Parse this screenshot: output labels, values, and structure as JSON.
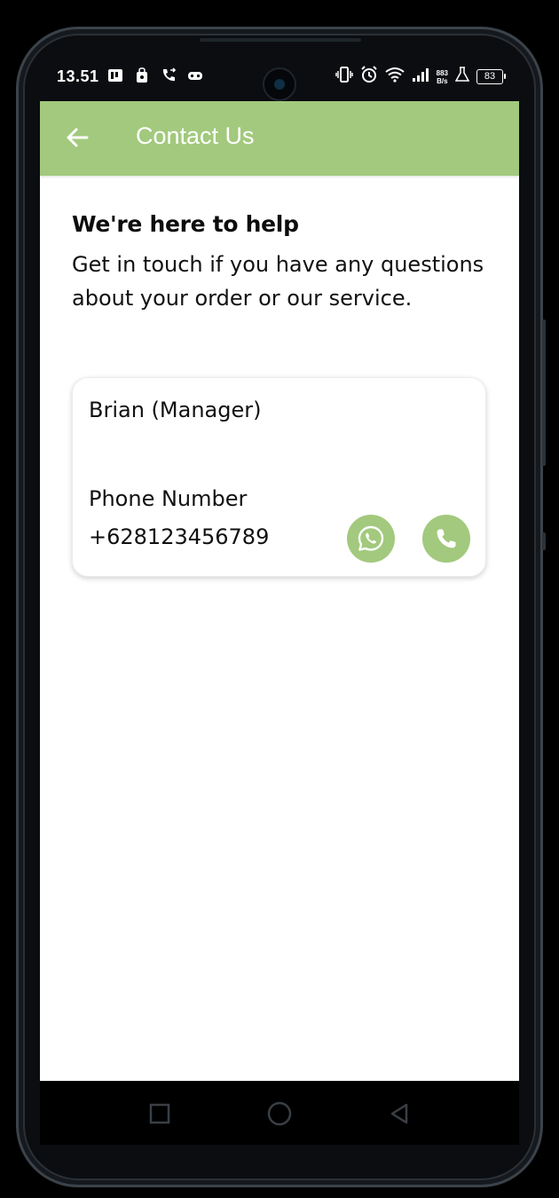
{
  "status_bar": {
    "time": "13.51",
    "net_speed_value": "883",
    "net_speed_unit": "B/s",
    "battery": "83",
    "left_icons": [
      "notification-app-icon",
      "notification-bag-icon",
      "call-forward-icon",
      "game-icon"
    ],
    "right_icons": [
      "vibrate-icon",
      "alarm-icon",
      "wifi-icon",
      "signal-icon",
      "flask-icon",
      "battery-icon"
    ]
  },
  "app_bar": {
    "title": "Contact Us",
    "back_icon": "arrow-left-icon",
    "background": "#a2c97d"
  },
  "content": {
    "heading": "We're here to help",
    "subtext": "Get in touch if you have any questions about your order or our service."
  },
  "contact": {
    "name": "Brian (Manager)",
    "phone_label": "Phone Number",
    "phone_number": "+628123456789",
    "whatsapp_icon": "whatsapp-icon",
    "call_icon": "phone-icon",
    "action_color": "#a2c97d"
  },
  "nav_bar": {
    "icons": [
      "recent-apps-icon",
      "home-icon",
      "back-icon"
    ]
  }
}
